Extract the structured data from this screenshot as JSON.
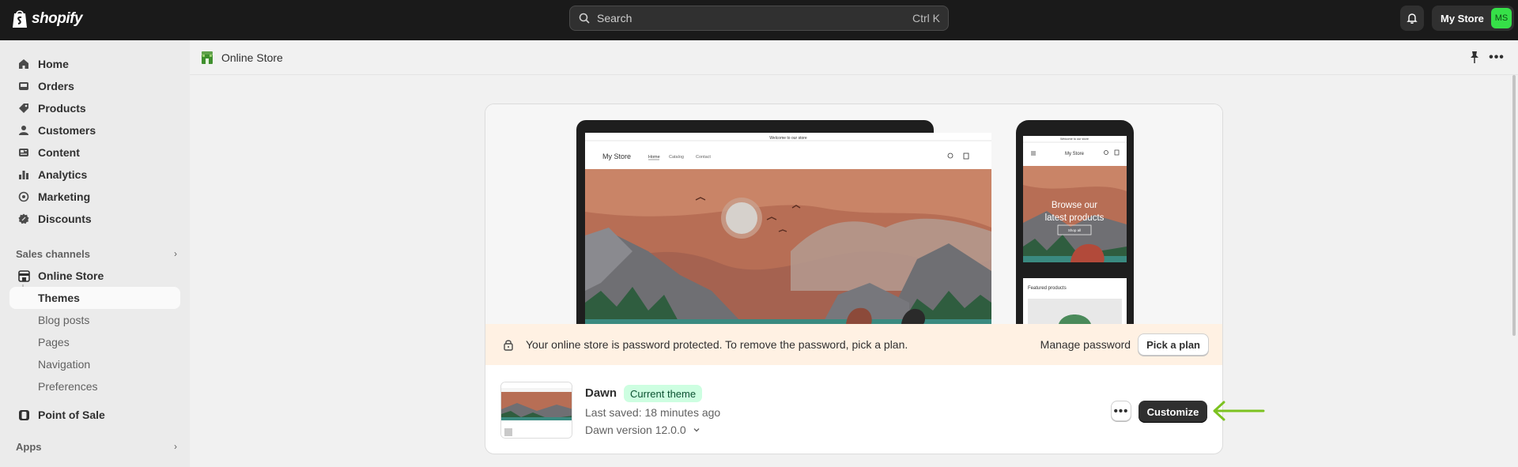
{
  "topbar": {
    "logo_text": "shopify",
    "search_placeholder": "Search",
    "search_shortcut": "Ctrl K",
    "store_name": "My Store",
    "avatar_initials": "MS"
  },
  "sidebar": {
    "main_items": [
      {
        "label": "Home",
        "icon": "home-icon"
      },
      {
        "label": "Orders",
        "icon": "orders-icon"
      },
      {
        "label": "Products",
        "icon": "tag-icon"
      },
      {
        "label": "Customers",
        "icon": "person-icon"
      },
      {
        "label": "Content",
        "icon": "content-icon"
      },
      {
        "label": "Analytics",
        "icon": "bar-chart-icon"
      },
      {
        "label": "Marketing",
        "icon": "target-icon"
      },
      {
        "label": "Discounts",
        "icon": "discount-icon"
      }
    ],
    "sales_channels_label": "Sales channels",
    "online_store_label": "Online Store",
    "online_store_subitems": [
      "Themes",
      "Blog posts",
      "Pages",
      "Navigation",
      "Preferences"
    ],
    "point_of_sale_label": "Point of Sale",
    "apps_label": "Apps"
  },
  "page": {
    "title": "Online Store"
  },
  "preview": {
    "announcement": "Welcome to our store",
    "store_name": "My Store",
    "nav_links": [
      "Home",
      "Catalog",
      "Contact"
    ],
    "mobile_hero_text_line1": "Browse our",
    "mobile_hero_text_line2": "latest products",
    "mobile_button": "Shop all",
    "featured_label": "Featured products"
  },
  "banner": {
    "text": "Your online store is password protected. To remove the password, pick a plan.",
    "manage_label": "Manage password",
    "pick_plan_label": "Pick a plan"
  },
  "theme": {
    "name": "Dawn",
    "badge": "Current theme",
    "saved": "Last saved: 18 minutes ago",
    "version": "Dawn version 12.0.0",
    "customize_label": "Customize"
  },
  "colors": {
    "accent_arrow": "#7cc220",
    "badge_bg": "#cdfee1",
    "banner_bg": "#fff1e3",
    "avatar_bg": "#36e048"
  }
}
